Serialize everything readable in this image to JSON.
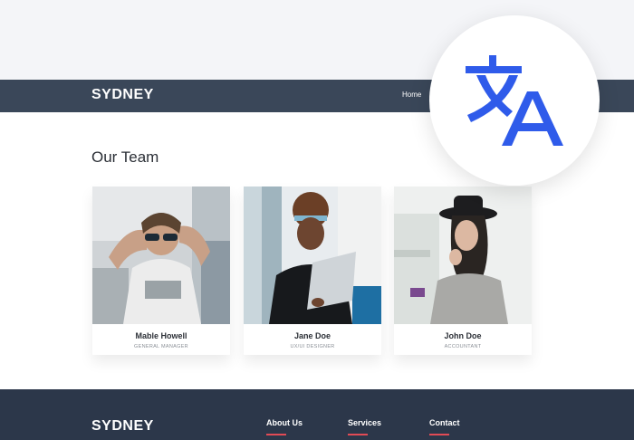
{
  "header": {
    "logo": "SYDNEY",
    "nav": {
      "home": "Home"
    }
  },
  "team": {
    "title": "Our Team",
    "members": [
      {
        "name": "Mable Howell",
        "role": "GENERAL MANAGER"
      },
      {
        "name": "Jane Doe",
        "role": "UX/UI DESIGNER"
      },
      {
        "name": "John Doe",
        "role": "ACCOUNTANT"
      }
    ]
  },
  "footer": {
    "logo": "SYDNEY",
    "links": [
      "About Us",
      "Services",
      "Contact"
    ]
  },
  "translate_badge": {
    "icon": "translate-icon",
    "color": "#2f5bea"
  },
  "colors": {
    "header_bg": "#3a4759",
    "footer_bg": "#2c374a",
    "accent": "#e24b55"
  }
}
